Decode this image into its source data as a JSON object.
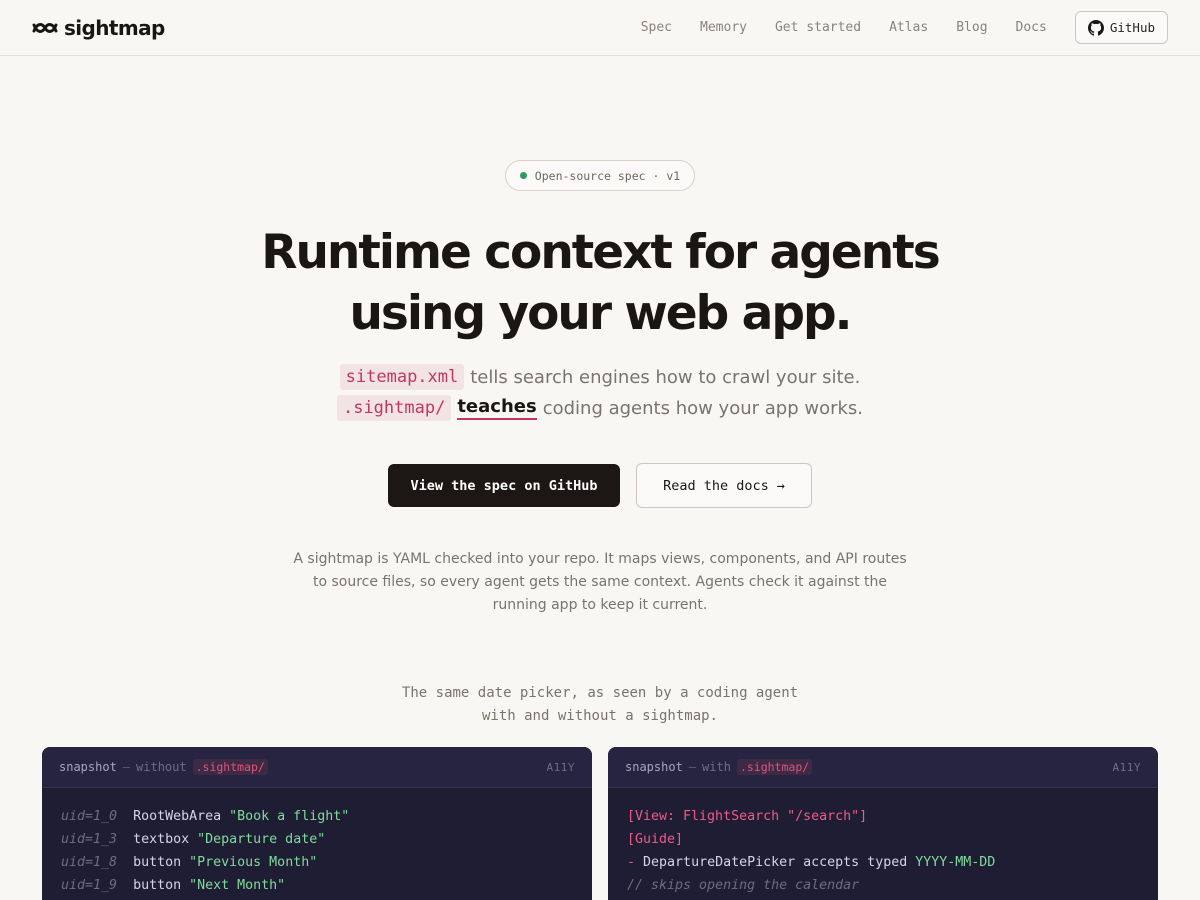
{
  "header": {
    "logo_text": "sightmap",
    "nav": [
      "Spec",
      "Memory",
      "Get started",
      "Atlas",
      "Blog",
      "Docs"
    ],
    "github_label": "GitHub"
  },
  "hero": {
    "badge": "Open-source spec · v1",
    "title_line1": "Runtime context for agents",
    "title_line2": "using your web app.",
    "tagline1_code": "sitemap.xml",
    "tagline1_text": "tells search engines how to crawl your site.",
    "tagline2_code": ".sightmap/",
    "tagline2_emphasis": "teaches",
    "tagline2_text": "coding agents how your app works.",
    "primary_button": "View the spec on GitHub",
    "secondary_button": "Read the docs",
    "secondary_arrow": "→",
    "description": "A sightmap is YAML checked into your repo. It maps views, components, and API routes to source files, so every agent gets the same context. Agents check it against the running app to keep it current.",
    "compare_caption_line1": "The same date picker, as seen by a coding agent",
    "compare_caption_line2": "with and without a sightmap."
  },
  "panels": {
    "left": {
      "label": "snapshot",
      "separator": "—",
      "mode": "without",
      "chip": ".sightmap/",
      "tag": "A11Y",
      "lines": [
        {
          "uid": "uid=1_0",
          "role": "RootWebArea",
          "name": "\"Book a flight\""
        },
        {
          "uid": "uid=1_3",
          "role": "textbox",
          "name": "\"Departure date\""
        },
        {
          "uid": "uid=1_8",
          "role": "button",
          "name": "\"Previous Month\""
        },
        {
          "uid": "uid=1_9",
          "role": "button",
          "name": "\"Next Month\""
        }
      ]
    },
    "right": {
      "label": "snapshot",
      "separator": "—",
      "mode": "with",
      "chip": ".sightmap/",
      "tag": "A11Y",
      "line1": "[View: FlightSearch \"/search\"]",
      "line2": "[Guide]",
      "line3_dash": "-",
      "line3_text": "DepartureDatePicker accepts typed",
      "line3_value": "YYYY-MM-DD",
      "line4": "// skips opening the calendar"
    }
  },
  "colors": {
    "background": "#f9f7f4",
    "accent_pink": "#c4365f",
    "primary_button": "#1c1715",
    "panel_bg": "#1f1d33",
    "code_string": "#7fdc9a",
    "badge_dot": "#2f9b63"
  },
  "icons": {
    "logo": "sightmap-logo-icon",
    "github": "github-icon"
  }
}
